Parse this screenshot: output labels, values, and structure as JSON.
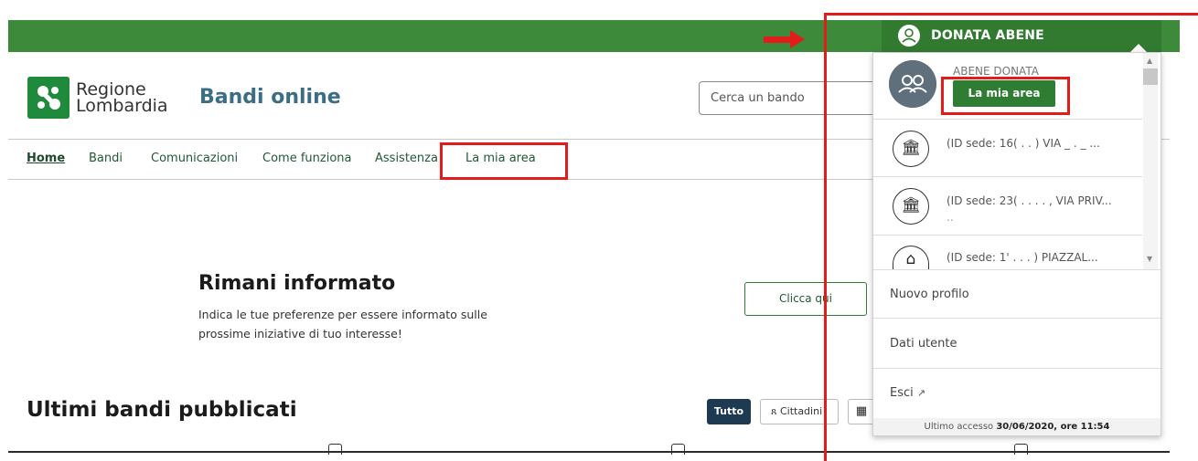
{
  "header": {
    "user_name": "DONATA ABENE",
    "logo_line1": "Regione",
    "logo_line2": "Lombardia",
    "site_title": "Bandi online",
    "search_placeholder": "Cerca un bando"
  },
  "nav": {
    "items": [
      {
        "label": "Home"
      },
      {
        "label": "Bandi"
      },
      {
        "label": "Comunicazioni"
      },
      {
        "label": "Come funziona"
      },
      {
        "label": "Assistenza"
      },
      {
        "label": "La mia area"
      }
    ]
  },
  "promo": {
    "title": "Rimani informato",
    "text": "Indica le tue preferenze per essere informato sulle prossime iniziative di tuo interesse!",
    "button_label": "Clicca qui"
  },
  "latest": {
    "title": "Ultimi bandi pubblicati",
    "filters": {
      "all_label": "Tutto",
      "citizens_label": "Cittadini"
    }
  },
  "dropdown": {
    "profile_name": "ABENE DONATA",
    "profile_initials": "ጸ",
    "my_area_label": "La mia area",
    "sedi": [
      {
        "text": "(ID sede: 16( . . ) VIA _ . _ ..."
      },
      {
        "text": "(ID sede: 23( . . . . , VIA PRIV...",
        "sub": ".."
      },
      {
        "text": "(ID sede: 1' . . . ) PIAZZAL..."
      }
    ],
    "links": {
      "new_profile": "Nuovo profilo",
      "user_data": "Dati utente",
      "logout": "Esci"
    },
    "last_access_prefix": "Ultimo accesso ",
    "last_access_value": "30/06/2020, ore 11:54"
  },
  "colors": {
    "brand_green": "#3e8a3b",
    "annotation_red": "#e41b1b",
    "title_blue": "#3b6e84"
  }
}
